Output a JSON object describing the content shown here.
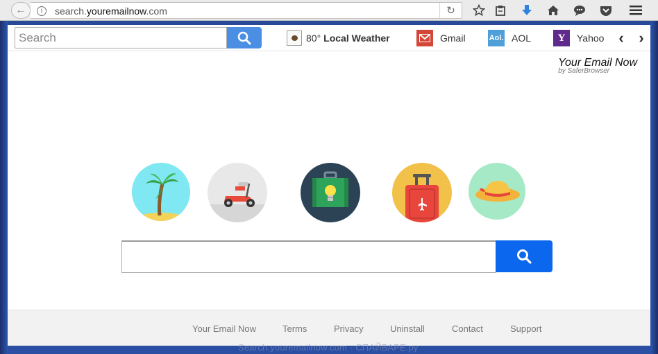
{
  "browser": {
    "url_prefix": "search.",
    "url_host": "youremailnow",
    "url_suffix": ".com",
    "icons": [
      "back-icon",
      "info-icon",
      "reload-icon",
      "star-icon",
      "clipboard-icon",
      "download-icon",
      "home-icon",
      "chat-icon",
      "pocket-icon",
      "menu-icon"
    ]
  },
  "toolbar": {
    "search_placeholder": "Search",
    "weather_temp": "80°",
    "weather_label": "Local Weather",
    "links": [
      {
        "label": "Gmail",
        "icon": "gmail-icon",
        "color": "#d44638"
      },
      {
        "label": "AOL",
        "icon": "aol-icon",
        "color": "#4f9fd9",
        "icon_text": "Aol."
      },
      {
        "label": "Yahoo",
        "icon": "yahoo-icon",
        "color": "#5f2a8c",
        "icon_text": "Y"
      }
    ]
  },
  "brand": {
    "title": "Your Email Now",
    "subtitle": "by SaferBrowser"
  },
  "circles": [
    {
      "name": "palm-tree-icon",
      "bg": "#7fe8f2"
    },
    {
      "name": "scooter-icon",
      "bg": "#e8e8e8"
    },
    {
      "name": "suitcase-bulb-icon",
      "bg": "#2c4356"
    },
    {
      "name": "luggage-icon",
      "bg": "#f2c14a"
    },
    {
      "name": "sun-hat-icon",
      "bg": "#a6e9c6"
    }
  ],
  "main_search": {
    "placeholder": ""
  },
  "footer": {
    "links": [
      "Your Email Now",
      "Terms",
      "Privacy",
      "Uninstall",
      "Contact",
      "Support"
    ]
  },
  "watermark": "Search.youremailnow.com - СПАЙВАРЕ.ру",
  "colors": {
    "search_button": "#0a67ee",
    "toolbar_search_button": "#4a8fe4"
  }
}
